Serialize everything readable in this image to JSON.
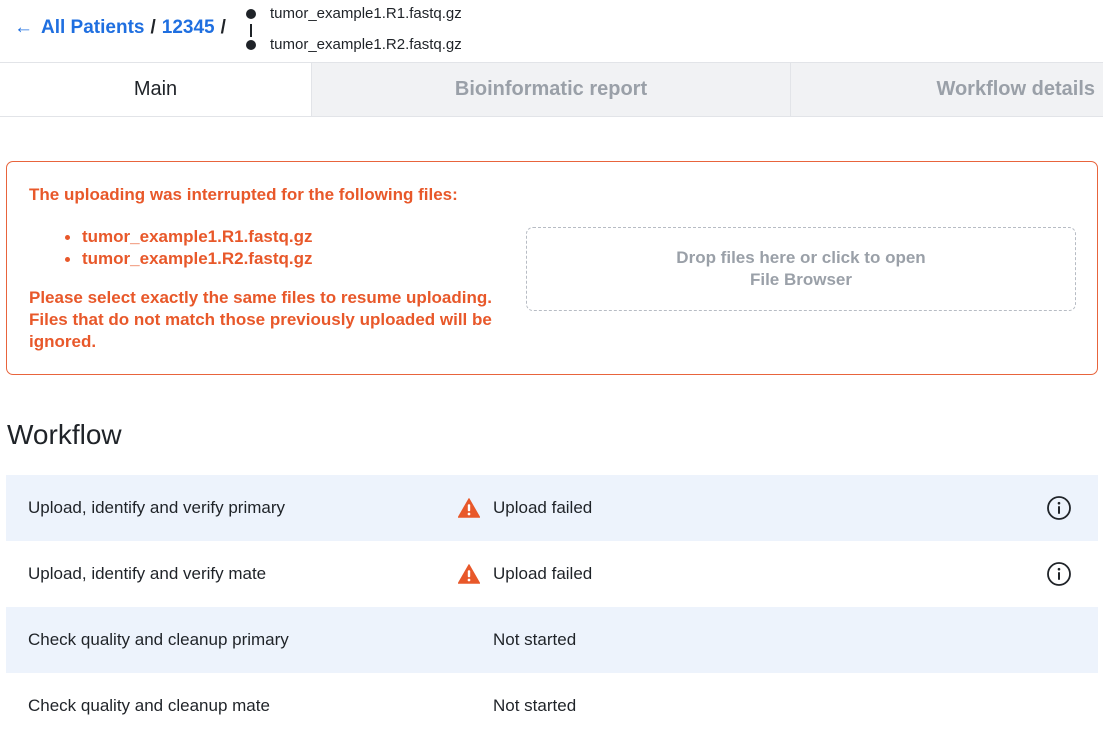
{
  "breadcrumb": {
    "back_arrow": "←",
    "all_patients": "All Patients",
    "separator": "/",
    "patient_id": "12345",
    "files": [
      "tumor_example1.R1.fastq.gz",
      "tumor_example1.R2.fastq.gz"
    ]
  },
  "tabs": [
    {
      "label": "Main",
      "active": true
    },
    {
      "label": "Bioinformatic report",
      "active": false
    },
    {
      "label": "Workflow details",
      "active": false
    }
  ],
  "alert": {
    "title": "The uploading was interrupted for the following files:",
    "files": [
      "tumor_example1.R1.fastq.gz",
      "tumor_example1.R2.fastq.gz"
    ],
    "note": "Please select exactly the same files to resume uploading. Files that do not match those previously uploaded will be ignored.",
    "dropzone_text": "Drop files here or click to open File Browser"
  },
  "workflow": {
    "title": "Workflow",
    "steps": [
      {
        "name": "Upload, identify and verify primary",
        "status": "Upload failed",
        "icon": "warning-icon",
        "info": "info-icon"
      },
      {
        "name": "Upload, identify and verify mate",
        "status": "Upload failed",
        "icon": "warning-icon",
        "info": "info-icon"
      },
      {
        "name": "Check quality and cleanup primary",
        "status": "Not started"
      },
      {
        "name": "Check quality and cleanup mate",
        "status": "Not started"
      }
    ]
  },
  "colors": {
    "link": "#1f6fe0",
    "error": "#e8582a",
    "row_shade": "#edf3fc",
    "tab_inactive_bg": "#f1f2f4",
    "muted_text": "#9aa0a8"
  }
}
